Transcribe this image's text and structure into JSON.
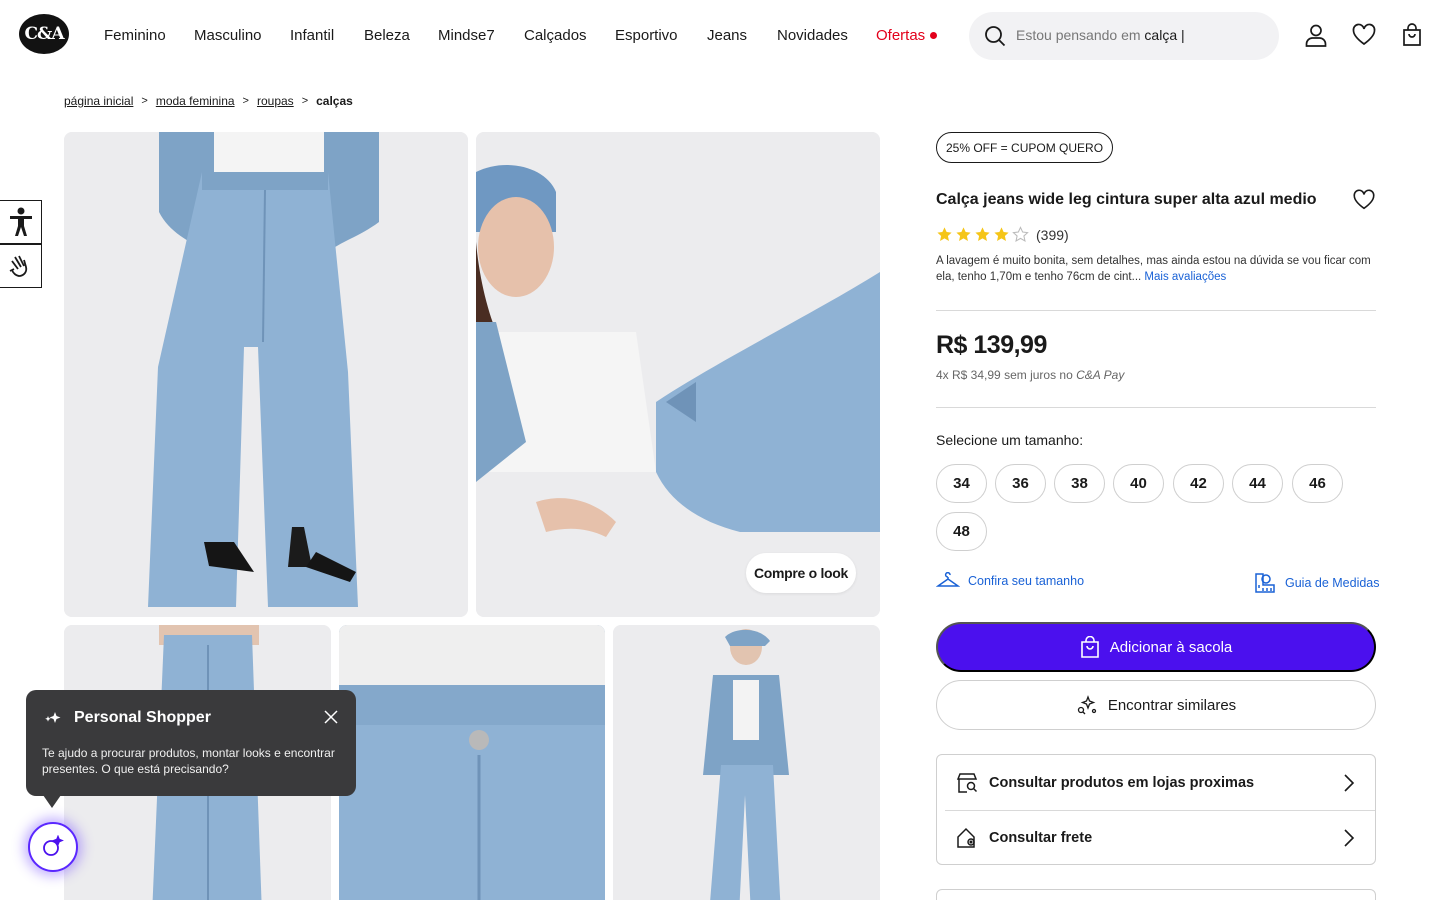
{
  "brand": {
    "logo_text": "C&A"
  },
  "nav": {
    "items": [
      "Feminino",
      "Masculino",
      "Infantil",
      "Beleza",
      "Mindse7",
      "Calçados",
      "Esportivo",
      "Jeans",
      "Novidades"
    ],
    "offers_label": "Ofertas"
  },
  "search": {
    "placeholder": "Estou pensando em",
    "typed": "calça"
  },
  "breadcrumb": [
    "página inicial",
    "moda feminina",
    "roupas"
  ],
  "breadcrumb_current": "calças",
  "gallery": {
    "look_button": "Compre o look"
  },
  "product": {
    "coupon": "25% OFF = CUPOM QUERO",
    "title": "Calça jeans wide leg cintura super alta azul medio",
    "rating": 4,
    "rating_max": 5,
    "review_count": "(399)",
    "review_text": "A lavagem é muito bonita, sem detalhes, mas ainda estou na dúvida se vou ficar com ela, tenho 1,70m e tenho 76cm de cint...",
    "review_link": "Mais avaliações",
    "price": "R$ 139,99",
    "installment_prefix": "4x R$ 34,99",
    "installment_mid": "sem juros no",
    "installment_pay": "C&A Pay"
  },
  "sizes": {
    "label": "Selecione um tamanho:",
    "options": [
      "34",
      "36",
      "38",
      "40",
      "42",
      "44",
      "46",
      "48"
    ]
  },
  "links": {
    "check_size": "Confira seu tamanho",
    "size_guide": "Guia de Medidas"
  },
  "actions": {
    "add_to_bag": "Adicionar à sacola",
    "find_similar": "Encontrar similares"
  },
  "options": {
    "stores": "Consultar produtos em lojas proximas",
    "shipping": "Consultar frete"
  },
  "personal_shopper": {
    "title": "Personal Shopper",
    "text": "Te ajudo a procurar produtos, montar looks e encontrar presentes. O que está precisando?"
  },
  "colors": {
    "accent": "#4b10ee",
    "offers": "#e3001b",
    "link": "#1a62d6",
    "star": "#f5c518",
    "denim": "#8fb2d4"
  }
}
